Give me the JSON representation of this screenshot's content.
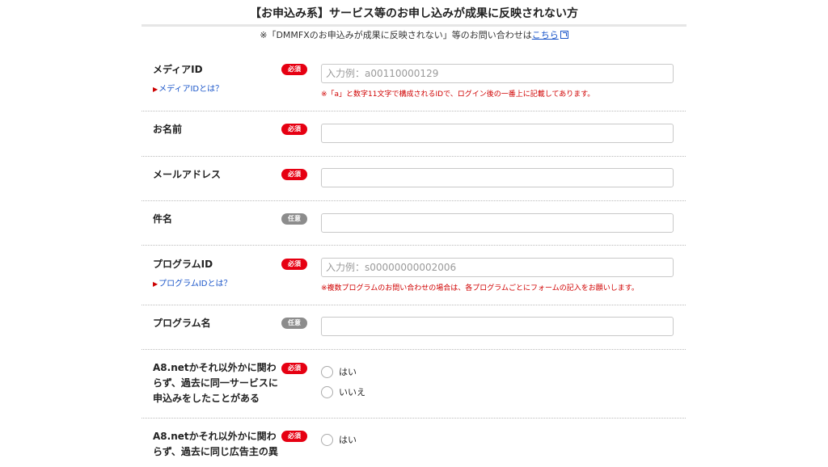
{
  "header": {
    "title": "【お申込み系】サービス等のお申し込みが成果に反映されない方",
    "notice_text": "※「DMMFXのお申込みが成果に反映されない」等のお問い合わせは",
    "notice_link": "こちら"
  },
  "form": {
    "badge_required": "必須",
    "badge_optional": "任意",
    "media_id": {
      "label": "メディアID",
      "help_link": "メディアIDとは？",
      "placeholder": "入力例：a00110000129",
      "hint": "※「a」と数字11文字で構成されるIDで、ログイン後の一番上に記載してあります。"
    },
    "name": {
      "label": "お名前"
    },
    "email": {
      "label": "メールアドレス"
    },
    "subject": {
      "label": "件名"
    },
    "program_id": {
      "label": "プログラムID",
      "help_link": "プログラムIDとは？",
      "placeholder": "入力例：s00000000002006",
      "hint": "※複数プログラムのお問い合わせの場合は、各プログラムごとにフォームの記入をお願いします。"
    },
    "program_name": {
      "label": "プログラム名"
    },
    "q1": {
      "label_line1": "A8.netかそれ以外かに関わ",
      "label_line2": "らず、過去に同一サービスに",
      "label_line3": "申込みをしたことがある",
      "options": [
        "はい",
        "いいえ"
      ]
    },
    "q2": {
      "label_line1": "A8.netかそれ以外かに関わ",
      "label_line2": "らず、過去に同じ広告主の異",
      "options": [
        "はい"
      ]
    }
  }
}
